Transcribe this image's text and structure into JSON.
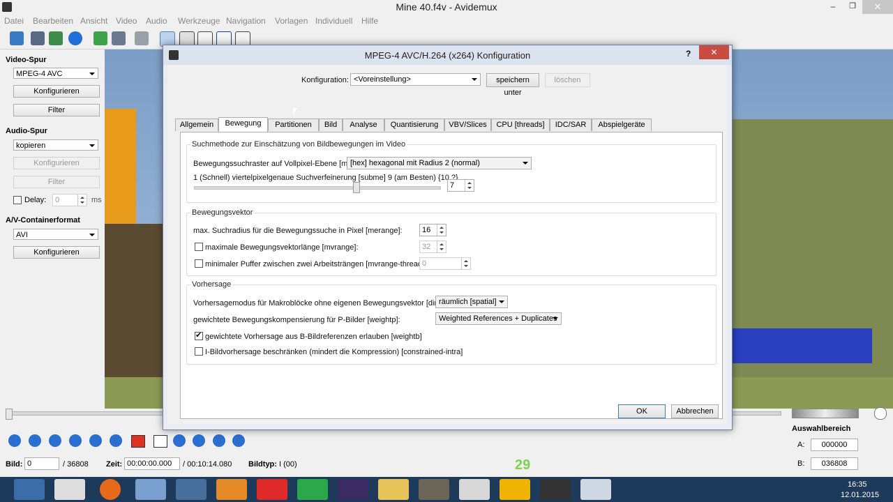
{
  "window": {
    "title": "Mine 40.f4v - Avidemux"
  },
  "menu": [
    "Datei",
    "Bearbeiten",
    "Ansicht",
    "Video",
    "Audio",
    "Werkzeuge",
    "Navigation",
    "Vorlagen",
    "Individuell",
    "Hilfe"
  ],
  "left_panel": {
    "video_heading": "Video-Spur",
    "video_codec": "MPEG-4 AVC",
    "configure": "Konfigurieren",
    "filter": "Filter",
    "audio_heading": "Audio-Spur",
    "audio_codec": "kopieren",
    "delay_label": "Delay:",
    "delay_value": "0",
    "delay_unit": "ms",
    "container_heading": "A/V-Containerformat",
    "container": "AVI"
  },
  "bottom": {
    "frame_label": "Bild:",
    "frame_value": "0",
    "frame_total": "/ 36808",
    "time_label": "Zeit:",
    "time_value": "00:00:00.000",
    "time_total": "/ 00:10:14.080",
    "frametype_label": "Bildtyp:",
    "frametype_value": "I (00)",
    "selection_label": "Auswahlbereich",
    "a_label": "A:",
    "a_value": "000000",
    "b_label": "B:",
    "b_value": "036808",
    "hud_level": "29"
  },
  "taskbar": {
    "time": "16:35",
    "date": "12.01.2015"
  },
  "dialog": {
    "title": "MPEG-4 AVC/H.264 (x264) Konfiguration",
    "help": "?",
    "config_label": "Konfiguration:",
    "config_value": "<Voreinstellung>",
    "save": "speichern unter",
    "delete": "löschen",
    "tabs": [
      "Allgemein",
      "Bewegung",
      "Partitionen",
      "Bild",
      "Analyse",
      "Quantisierung",
      "VBV/Slices",
      "CPU [threads]",
      "IDC/SAR",
      "Abspielgeräte"
    ],
    "active_tab": "Bewegung",
    "group1": {
      "title": "Suchmethode zur Einschätzung von Bildbewegungen im Video",
      "me_label": "Bewegungssuchraster auf Vollpixel-Ebene [me]:",
      "me_value": "[hex] hexagonal mit Radius 2 (normal)",
      "subme_label": "1 (Schnell)  viertelpixelgenaue Suchverfeinerung [subme] 9 (am Besten)  {10 ?}",
      "subme_value": "7",
      "subme_level": 0.6
    },
    "group2": {
      "title": "Bewegungsvektor",
      "merange_label": "max. Suchradius für die Bewegungssuche in Pixel [merange]:",
      "merange_value": "16",
      "mvrange_label": "maximale Bewegungsvektorlänge [mvrange]:",
      "mvrange_value": "32",
      "thread_label": "minimaler Puffer zwischen zwei Arbeitsträngen [mvrange-thread]:",
      "thread_value": "0"
    },
    "group3": {
      "title": "Vorhersage",
      "direct_label": "Vorhersagemodus für Makroblöcke ohne eigenen Bewegungsvektor [direct]:",
      "direct_value": "räumlich [spatial]",
      "weightp_label": "gewichtete Bewegungskompensierung für P-Bilder [weightp]:",
      "weightp_value": "Weighted References + Duplicates",
      "weightb_label": "gewichtete Vorhersage aus B-Bildreferenzen erlauben [weightb]",
      "intra_label": "I-Bildvorhersage beschränken (mindert die Kompression) [constrained-intra]"
    },
    "ok": "OK",
    "cancel": "Abbrechen"
  }
}
